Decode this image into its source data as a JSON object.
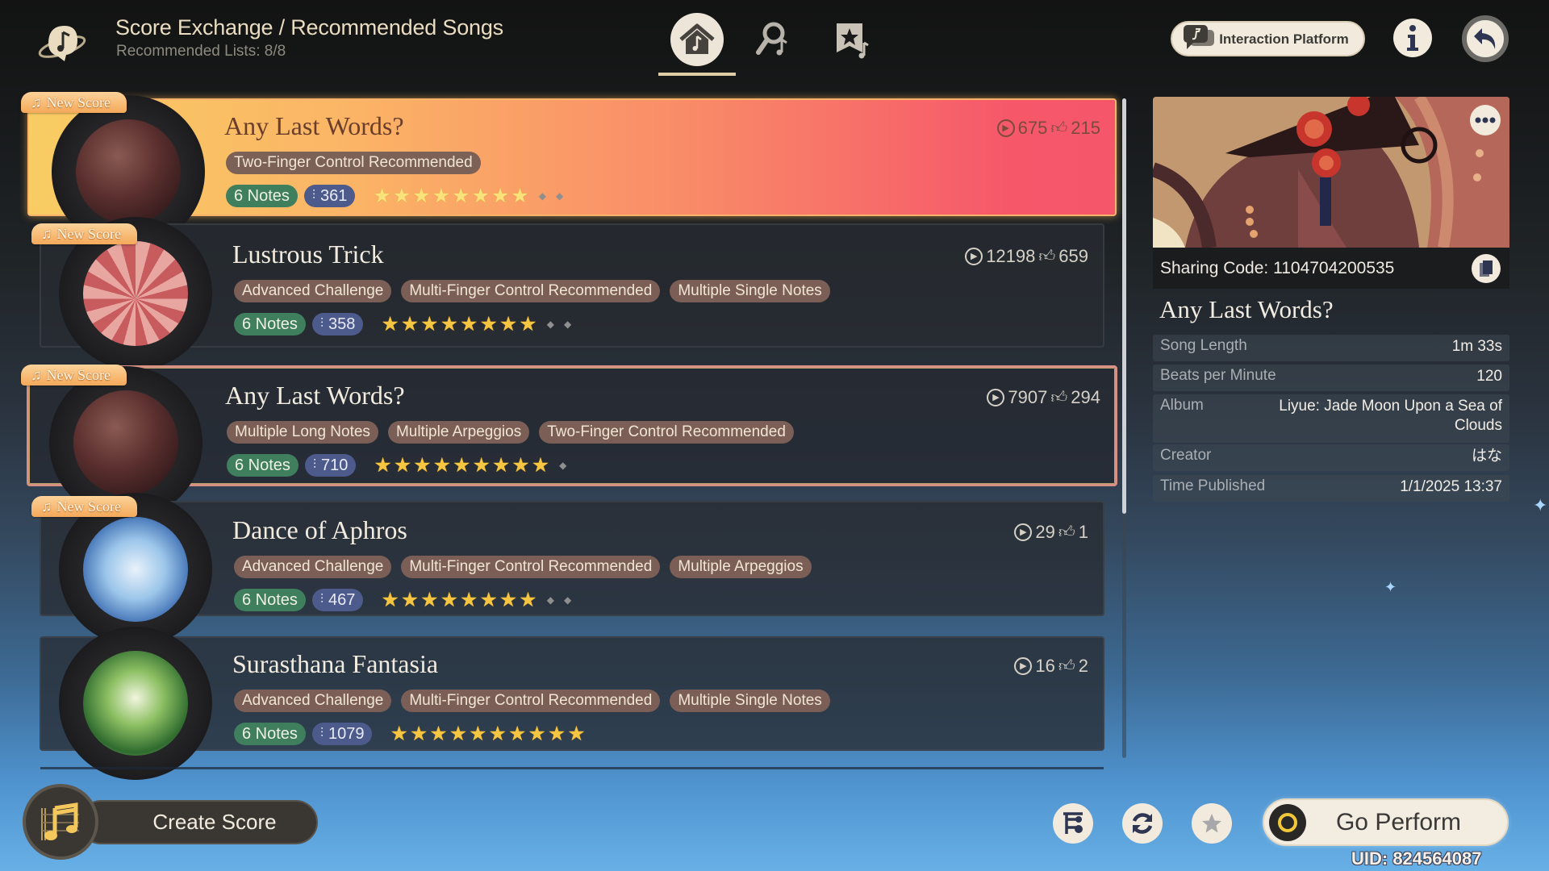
{
  "header": {
    "title": "Score Exchange / Recommended Songs",
    "subtitle": "Recommended Lists: 8/8",
    "tabs": [
      {
        "name": "home",
        "icon": "home-music-icon",
        "active": true
      },
      {
        "name": "search",
        "icon": "search-music-icon",
        "active": false
      },
      {
        "name": "favorites",
        "icon": "bookmark-star-icon",
        "active": false
      }
    ],
    "interaction_platform_label": "Interaction Platform",
    "info_icon": "info-icon",
    "back_icon": "back-arrow-icon"
  },
  "songs": [
    {
      "title": "Any Last Words?",
      "new_badge": "New Score",
      "plays": "675",
      "likes": "215",
      "tags": [
        "Two-Finger Control Recommended"
      ],
      "notes": "6 Notes",
      "note_count": "361",
      "difficulty": 8,
      "difficulty_max": 10,
      "state": "highlighted",
      "art": "hutao"
    },
    {
      "title": "Lustrous Trick",
      "new_badge": "New Score",
      "plays": "12198",
      "likes": "659",
      "tags": [
        "Advanced Challenge",
        "Multi-Finger Control Recommended",
        "Multiple Single Notes"
      ],
      "notes": "6 Notes",
      "note_count": "358",
      "difficulty": 8,
      "difficulty_max": 10,
      "state": "normal",
      "art": "lyney"
    },
    {
      "title": "Any Last Words?",
      "new_badge": "New Score",
      "plays": "7907",
      "likes": "294",
      "tags": [
        "Multiple Long Notes",
        "Multiple Arpeggios",
        "Two-Finger Control Recommended"
      ],
      "notes": "6 Notes",
      "note_count": "710",
      "difficulty": 9,
      "difficulty_max": 10,
      "state": "selected",
      "art": "hutao"
    },
    {
      "title": "Dance of Aphros",
      "new_badge": "New Score",
      "plays": "29",
      "likes": "1",
      "tags": [
        "Advanced Challenge",
        "Multi-Finger Control Recommended",
        "Multiple Arpeggios"
      ],
      "notes": "6 Notes",
      "note_count": "467",
      "difficulty": 8,
      "difficulty_max": 10,
      "state": "normal",
      "art": "furina"
    },
    {
      "title": "Surasthana Fantasia",
      "new_badge": "",
      "plays": "16",
      "likes": "2",
      "tags": [
        "Advanced Challenge",
        "Multi-Finger Control Recommended",
        "Multiple Single Notes"
      ],
      "notes": "6 Notes",
      "note_count": "1079",
      "difficulty": 10,
      "difficulty_max": 10,
      "state": "normal",
      "art": "nahida"
    }
  ],
  "scroll": {
    "position_fraction": 0.0,
    "visible_fraction": 0.63
  },
  "detail": {
    "sharing_code_label": "Sharing Code: 1104704200535",
    "title": "Any Last Words?",
    "info": [
      {
        "key": "Song Length",
        "value": "1m 33s"
      },
      {
        "key": "Beats per Minute",
        "value": "120"
      },
      {
        "key": "Album",
        "value": "Liyue: Jade Moon Upon a Sea of Clouds"
      },
      {
        "key": "Creator",
        "value": "はな"
      },
      {
        "key": "Time Published",
        "value": "1/1/2025 13:37"
      }
    ]
  },
  "footer": {
    "create_label": "Create Score",
    "perform_label": "Go Perform",
    "uid": "UID: 824564087",
    "buttons": [
      "filter-icon",
      "refresh-icon",
      "star-icon"
    ]
  },
  "colors": {
    "accent_gold": "#f6c643",
    "tag_brown": "#7b5f56",
    "notes_green": "#3f7f5d",
    "count_blue": "#4d5a8c",
    "selected_border": "#d88f84"
  }
}
